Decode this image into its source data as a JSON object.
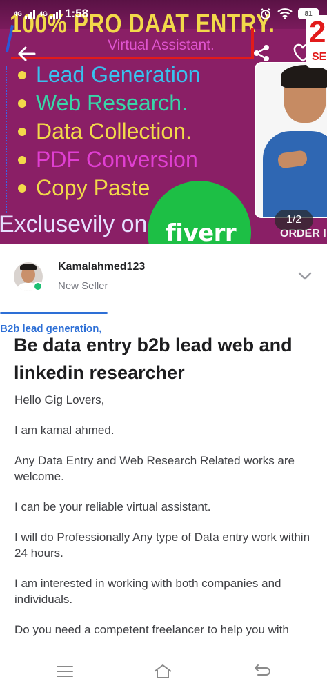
{
  "status_bar": {
    "network_1": "4G",
    "network_2": "4G",
    "time": "1:58",
    "battery": "81"
  },
  "banner": {
    "headline": "100% PRO DAAT ENTRY.",
    "subtitle": "Virtual Assistant.",
    "bullets": [
      {
        "text": "Lead Generation",
        "color": "#38c0ee"
      },
      {
        "text": "Web Research.",
        "color": "#38d6a8"
      },
      {
        "text": "Data Collection.",
        "color": "#f2d94a"
      },
      {
        "text": "PDF Conversion",
        "color": "#e03fd2"
      },
      {
        "text": "Copy Paste",
        "color": "#f2d94a"
      }
    ],
    "footer_text": "Exclusevily on",
    "fiverr_logo": "fiverr",
    "side_number": "2",
    "side_text": "SE",
    "order_text": "ORDER I",
    "page_indicator": "1/2"
  },
  "seller": {
    "username": "Kamalahmed123",
    "level": "New Seller"
  },
  "tag_label": "B2b lead generation,",
  "gig": {
    "title": "Be data entry b2b lead web and linkedin researcher",
    "description": [
      "Hello Gig Lovers,",
      "I am kamal ahmed.",
      "Any Data Entry and Web Research Related works are welcome.",
      "I can be your reliable virtual assistant.",
      "I will do Professionally Any type of Data entry work within 24 hours.",
      "I am interested in working with both companies and individuals.",
      "Do you need a competent freelancer to help you with"
    ]
  },
  "colors": {
    "banner_bg": "#8a1f66",
    "fiverr_green": "#1dbf45",
    "online_green": "#1dbf73",
    "link_blue": "#2d6fd6"
  }
}
